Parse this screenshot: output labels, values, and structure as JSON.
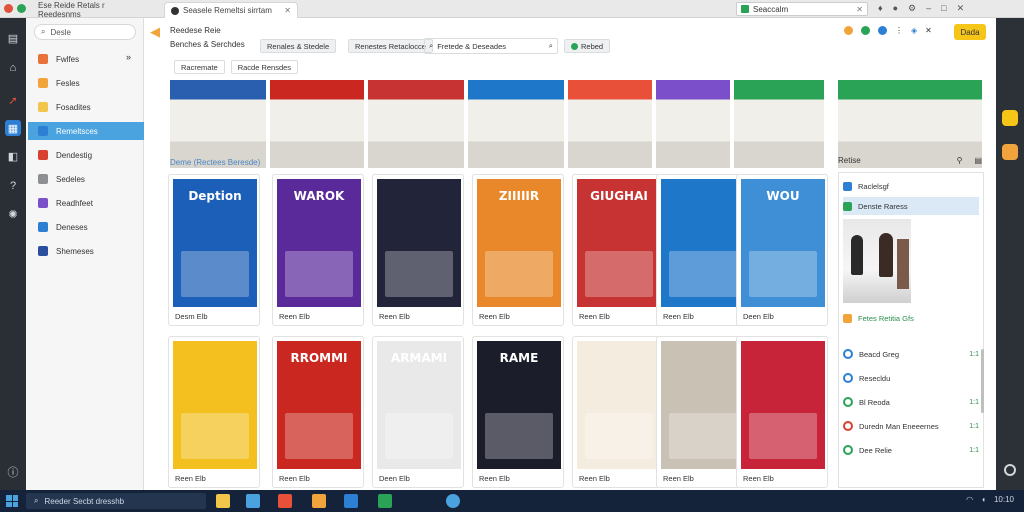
{
  "tabs": [
    {
      "label": "Ese Reide Retals r Reedesnms",
      "active": false
    },
    {
      "label": "Seasele Remeltsi sirrtam",
      "active": true
    }
  ],
  "address": {
    "value": "Seaccalm"
  },
  "sidebar": {
    "search_placeholder": "Desle",
    "items": [
      {
        "label": "Fwlfes",
        "color": "#e8733a"
      },
      {
        "label": "Fesles",
        "color": "#f2a43c"
      },
      {
        "label": "Fosadites",
        "color": "#f2c64a"
      },
      {
        "label": "Remeltsces",
        "color": "#2d7fd4",
        "selected": true
      },
      {
        "label": "Dendestig",
        "color": "#d9412f"
      },
      {
        "label": "Sedeles",
        "color": "#8d8f93"
      },
      {
        "label": "Readhfeet",
        "color": "#7a4fc9"
      },
      {
        "label": "Deneses",
        "color": "#2d7fd4"
      },
      {
        "label": "Shemeses",
        "color": "#2a4f9f"
      }
    ]
  },
  "toolbar": {
    "breadcrumb": "Reedese Reie",
    "path": "Benches & Serchdes",
    "filter1": "Renales & Stedele",
    "filter2": "Renestes Retaclocce",
    "search": "Fretede & Deseades",
    "badge": "Rebed",
    "action_label": "Dada"
  },
  "strip": {
    "chip1": "Racremate",
    "chip2": "Racde Rensdes"
  },
  "section_title": "Deme (Rectees Beresde)",
  "grid_row1": [
    {
      "caption": "Desm Elb",
      "title": "Deption",
      "bg": "#1c5fb8"
    },
    {
      "caption": "Reen Elb",
      "title": "WAROK",
      "bg": "#5b2a9a"
    },
    {
      "caption": "Reen Elb",
      "title": "",
      "bg": "#22243a"
    },
    {
      "caption": "Reen Elb",
      "title": "ZIIIIIR",
      "bg": "#e8882a"
    },
    {
      "caption": "Reen Elb",
      "title": "GIUGHAI",
      "bg": "#c73232"
    },
    {
      "caption": "Reen Elb",
      "title": "",
      "bg": "#1f77c9"
    },
    {
      "caption": "Deen Elb",
      "title": "WOU",
      "bg": "#3f8fd6"
    }
  ],
  "grid_row2": [
    {
      "caption": "Reen Elb",
      "title": "",
      "bg": "#f4c020"
    },
    {
      "caption": "Reen Elb",
      "title": "RROMMI",
      "bg": "#c9271f"
    },
    {
      "caption": "Deen Elb",
      "title": "ARMAMI",
      "bg": "#e9e9e9"
    },
    {
      "caption": "Reen Elb",
      "title": "RAME",
      "bg": "#1b1d2b"
    },
    {
      "caption": "Reen Elb",
      "title": "",
      "bg": "#f5ece0"
    },
    {
      "caption": "Reen Elb",
      "title": "",
      "bg": "#c9c1b3"
    },
    {
      "caption": "Reen Elb",
      "title": "",
      "bg": "#c7243a"
    }
  ],
  "rpanel": {
    "header": "Retise",
    "item1": "Raclelsgf",
    "item2": "Denste Raress",
    "highlight": "Fetes Retitia Gfs",
    "list": [
      {
        "label": "Beacd Greg",
        "value": "1:1"
      },
      {
        "label": "Resecldu",
        "value": ""
      },
      {
        "label": "Bl Reoda",
        "value": "1:1"
      },
      {
        "label": "Duredn Man Eneeernes",
        "value": "1:1"
      },
      {
        "label": "Dee Relie",
        "value": "1:1"
      }
    ]
  },
  "taskbar": {
    "search": "Reeder Secbt dresshb",
    "clock": "10:10"
  },
  "colors": {
    "accent": "#4aa3df",
    "cta": "#f5c518",
    "green": "#2a9b4a"
  }
}
